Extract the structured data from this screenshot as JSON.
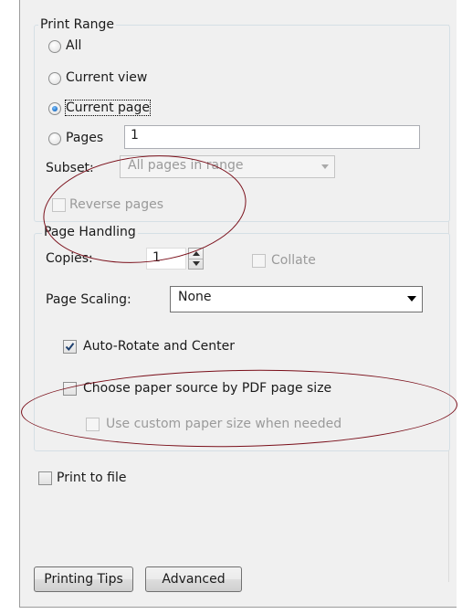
{
  "print_range": {
    "title": "Print Range",
    "options": [
      {
        "label": "All",
        "selected": false
      },
      {
        "label": "Current view",
        "selected": false
      },
      {
        "label": "Current page",
        "selected": true
      },
      {
        "label": "Pages",
        "selected": false
      }
    ],
    "pages_value": "1",
    "subset_label": "Subset:",
    "subset_value": "All pages in range",
    "reverse_pages_label": "Reverse pages",
    "reverse_pages_checked": false
  },
  "page_handling": {
    "title": "Page Handling",
    "copies_label": "Copies:",
    "copies_value": "1",
    "collate_label": "Collate",
    "collate_checked": false,
    "page_scaling_label": "Page Scaling:",
    "page_scaling_value": "None",
    "auto_rotate_label": "Auto-Rotate and Center",
    "auto_rotate_checked": true,
    "paper_source_label": "Choose paper source by PDF page size",
    "paper_source_checked": false,
    "custom_paper_label": "Use custom paper size when needed",
    "custom_paper_checked": false
  },
  "print_to_file": {
    "label": "Print to file",
    "checked": false
  },
  "buttons": {
    "printing_tips": "Printing Tips",
    "advanced": "Advanced"
  },
  "colors": {
    "annotation_ellipse": "#7a0f1a",
    "dialog_bg": "#f0f0f0",
    "group_border": "#d5dfe5"
  }
}
